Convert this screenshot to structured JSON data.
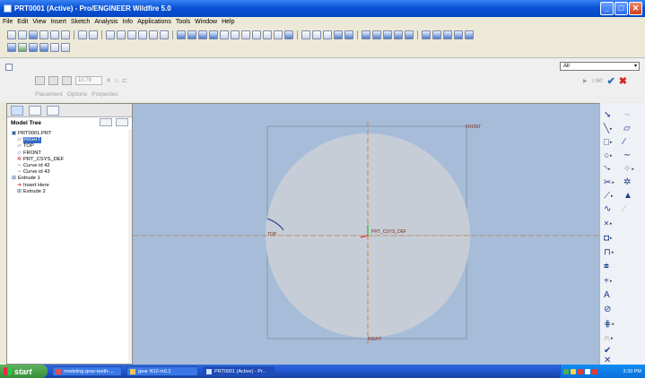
{
  "window": {
    "title": "PRT0001 (Active) - Pro/ENGINEER Wildfire 5.0",
    "min": "_",
    "max": "□",
    "close": "✕"
  },
  "menu": [
    "File",
    "Edit",
    "View",
    "Insert",
    "Sketch",
    "Analysis",
    "Info",
    "Applications",
    "Tools",
    "Window",
    "Help"
  ],
  "dashboard": {
    "depth_value": "10.79",
    "tabs": [
      "Placement",
      "Options",
      "Properties"
    ],
    "filter_value": "All",
    "pause_label": "▶",
    "preview_label": "☺60'",
    "ok_icon": "ok-check-icon",
    "cancel_icon": "cancel-x-icon"
  },
  "model_tree": {
    "title": "Model Tree",
    "items": [
      {
        "label": "PRT0001.PRT",
        "icon": "part-icon",
        "level": 0
      },
      {
        "label": "RIGHT",
        "icon": "datum-plane-icon",
        "level": 1,
        "selected": true
      },
      {
        "label": "TOP",
        "icon": "datum-plane-icon",
        "level": 1
      },
      {
        "label": "FRONT",
        "icon": "datum-plane-icon",
        "level": 1
      },
      {
        "label": "PRT_CSYS_DEF",
        "icon": "csys-icon",
        "level": 1
      },
      {
        "label": "Curve id 42",
        "icon": "curve-icon",
        "level": 1
      },
      {
        "label": "Curve id 43",
        "icon": "curve-icon",
        "level": 1
      },
      {
        "label": "Extrude 1",
        "icon": "extrude-icon",
        "level": 0
      },
      {
        "label": "Insert Here",
        "icon": "insert-arrow-icon",
        "level": 1
      },
      {
        "label": "Extrude 2",
        "icon": "extrude-icon",
        "level": 1
      }
    ]
  },
  "graphics": {
    "label_front": "FRONT",
    "label_top": "TOP",
    "label_csys": "PRT_CSYS_DEF",
    "label_right": "RIGHT"
  },
  "taskbar": {
    "start_label": "start",
    "tasks": [
      {
        "label": "modeling-gear-teeth-...",
        "active": false
      },
      {
        "label": "gear N10 m0.1",
        "active": false
      },
      {
        "label": "PRT0001 (Active) - Pr...",
        "active": true
      }
    ],
    "clock": "3:33 PM"
  },
  "colors": {
    "graphics_bg": "#a7bcd8",
    "sketch_circle": "#c7cdd6",
    "datum_line": "#d07a2a",
    "xp_blue": "#245edb"
  }
}
